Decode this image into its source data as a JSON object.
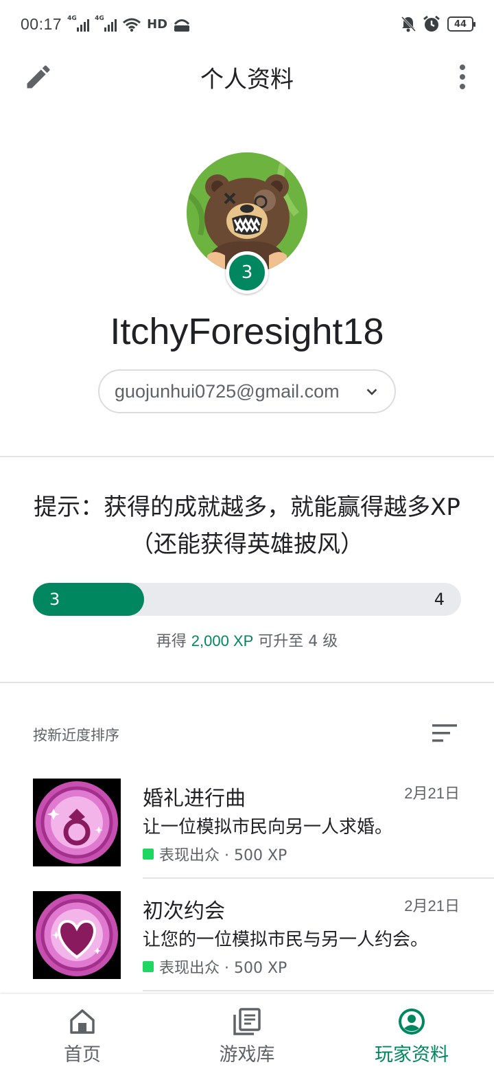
{
  "status_bar": {
    "time": "00:17",
    "net1": "4G",
    "net2": "4G",
    "hd": "HD",
    "battery": "44"
  },
  "app_bar": {
    "title": "个人资料"
  },
  "profile": {
    "level": "3",
    "username": "ItchyForesight18",
    "email": "guojunhui0725@gmail.com"
  },
  "progress": {
    "tip": "提示：获得的成就越多，就能赢得越多XP（还能获得英雄披风）",
    "current_level": "3",
    "next_level": "4",
    "fill_fraction": 0.26,
    "caption_prefix": "再得 ",
    "caption_xp": "2,000 XP",
    "caption_suffix": " 可升至 4 级"
  },
  "sort": {
    "label": "按新近度排序"
  },
  "achievements": [
    {
      "title": "婚礼进行曲",
      "date": "2月21日",
      "description": "让一位模拟市民向另一人求婚。",
      "meta": "表现出众 · 500 XP",
      "icon": "ring-badge-icon"
    },
    {
      "title": "初次约会",
      "date": "2月21日",
      "description": "让您的一位模拟市民与另一人约会。",
      "meta": "表现出众 · 500 XP",
      "icon": "heart-badge-icon"
    }
  ],
  "bottom_nav": {
    "items": [
      {
        "label": "首页",
        "icon": "home-icon"
      },
      {
        "label": "游戏库",
        "icon": "library-icon"
      },
      {
        "label": "玩家资料",
        "icon": "profile-icon"
      }
    ],
    "active_index": 2
  },
  "colors": {
    "accent": "#01875f",
    "rarity": "#1ed760",
    "badge_purple": "#b3389a"
  }
}
